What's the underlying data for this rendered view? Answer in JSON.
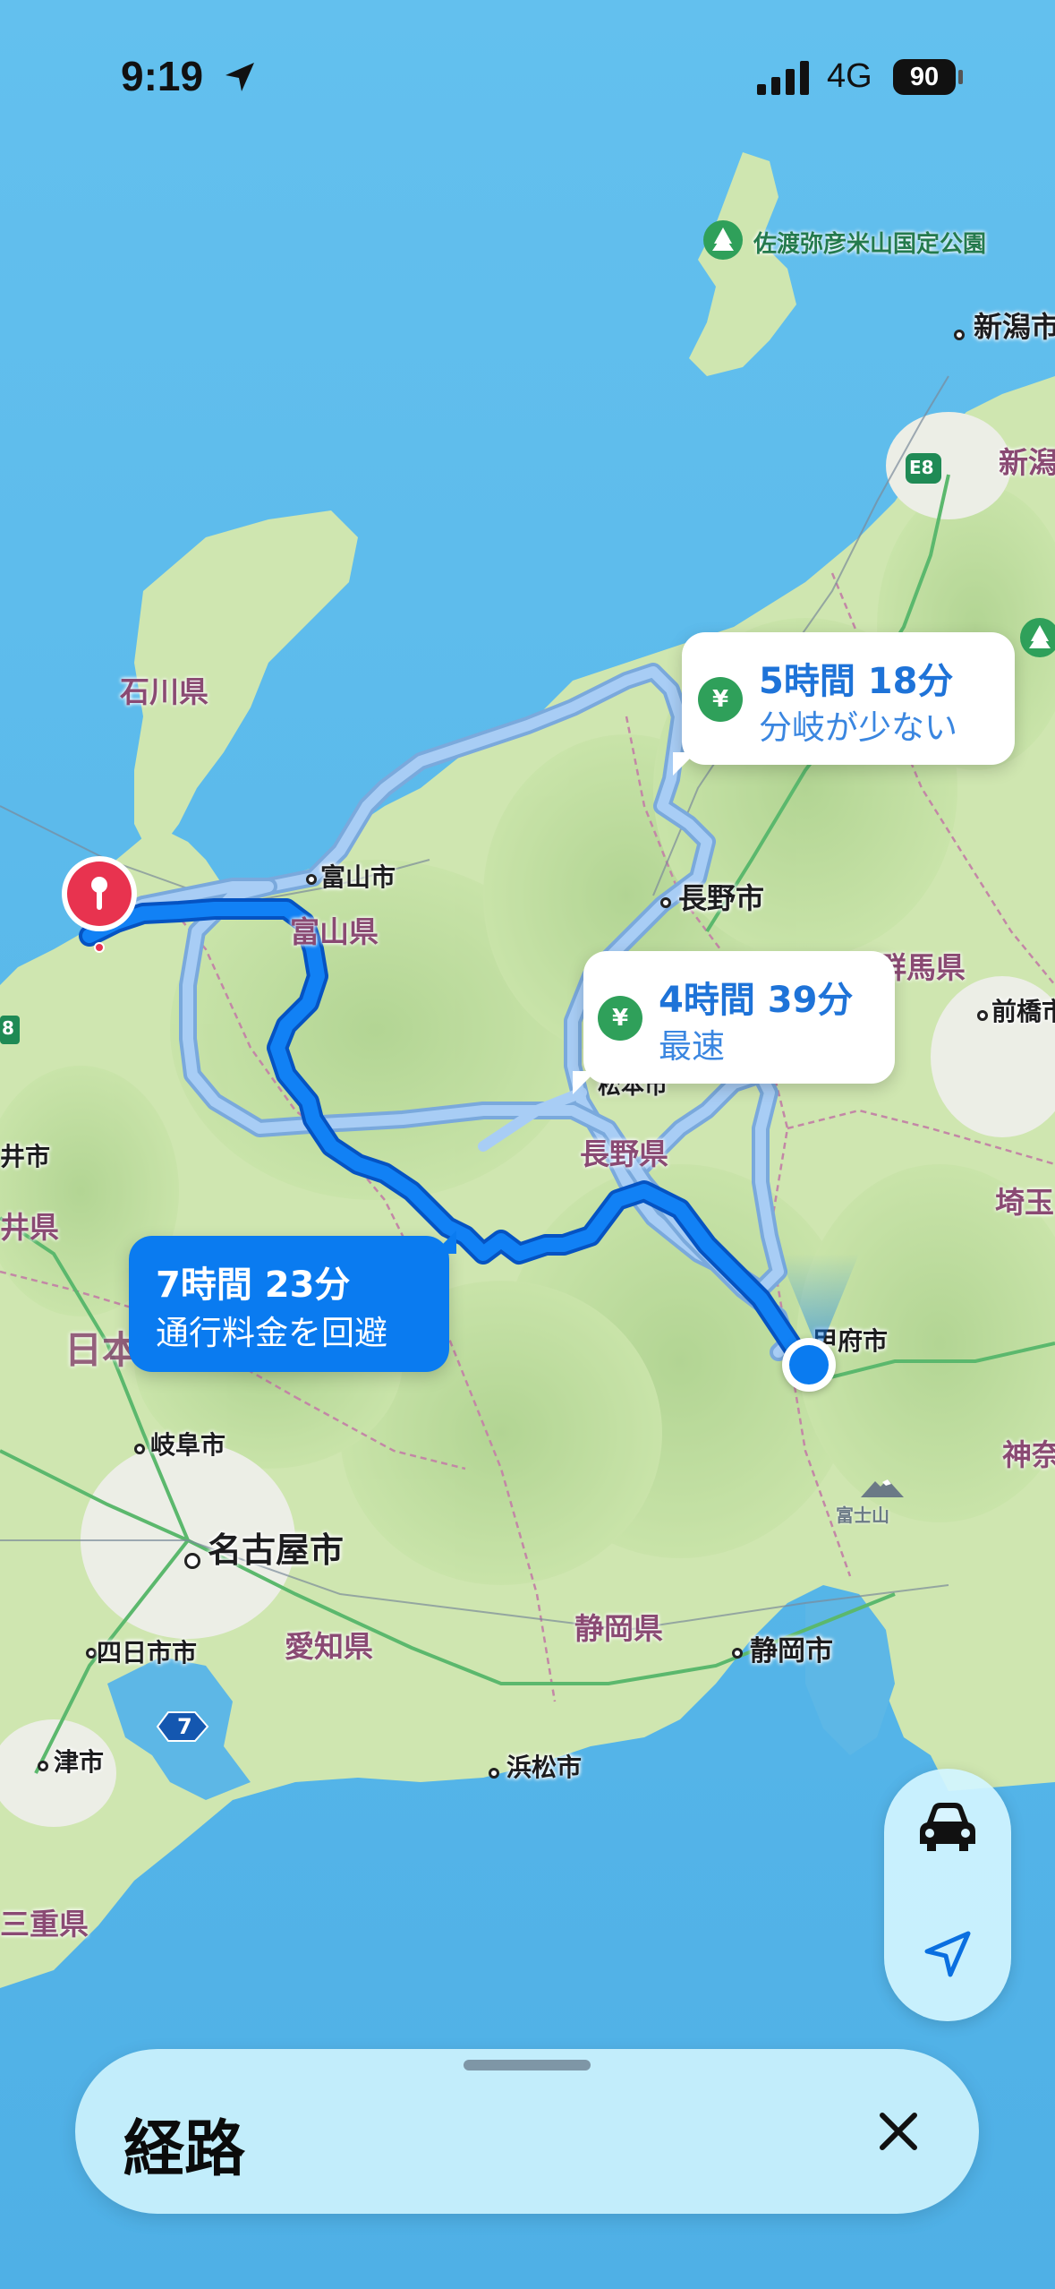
{
  "status_bar": {
    "time": "9:19",
    "network": "4G",
    "battery": "90"
  },
  "map": {
    "labels": {
      "sado_park": "佐渡弥彦米山国定公園",
      "niigata_city": "新潟市",
      "niigata_pref": "新潟",
      "e8_shield": "E8",
      "ishikawa": "石川県",
      "toyama_city": "富山市",
      "toyama_pref": "富山県",
      "nagano_city": "長野市",
      "gunma": "群馬県",
      "maebashi": "前橋市",
      "matsumoto_partial": "松本市",
      "nagano_pref": "長野県",
      "saitama": "埼玉",
      "kofu": "甲府市",
      "kanagawa": "神奈",
      "fuji": "富士山",
      "left_city_partial": "井市",
      "fukui_partial": "井県",
      "nihon_partial": "日本",
      "left_shield": "8",
      "gifu": "岐阜市",
      "nagoya": "名古屋市",
      "aichi": "愛知県",
      "shizuoka_pref": "静岡県",
      "shizuoka_city": "静岡市",
      "yokkaichi": "四日市市",
      "route7": "7",
      "tsu": "津市",
      "hamamatsu": "浜松市",
      "mie": "三重県"
    },
    "routes": [
      {
        "time": "5時間 18分",
        "note": "分岐が少ない",
        "toll": true,
        "selected": false
      },
      {
        "time": "4時間 39分",
        "note": "最速",
        "toll": true,
        "selected": false
      },
      {
        "time": "7時間 23分",
        "note": "通行料金を回避",
        "toll": false,
        "selected": true
      }
    ],
    "toll_symbol": "¥",
    "colors": {
      "route_selected": "#0a6ff0",
      "route_alt": "#9cc7f5",
      "origin": "#0a7bf0",
      "destination_pin": "#e8334f"
    }
  },
  "controls": {
    "drive_mode_icon": "car-icon",
    "locate_icon": "location-arrow-icon"
  },
  "sheet": {
    "title": "経路"
  }
}
